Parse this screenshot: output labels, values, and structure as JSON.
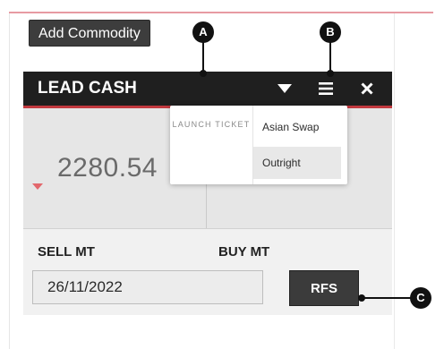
{
  "toolbar": {
    "add_commodity_label": "Add Commodity"
  },
  "widget": {
    "title": "LEAD CASH",
    "price": "2280.54",
    "sell_label": "SELL MT",
    "buy_label": "BUY MT",
    "date_value": "26/11/2022",
    "rfs_label": "RFS"
  },
  "dropdown": {
    "launch_ticket_label": "LAUNCH TICKET",
    "items": [
      {
        "label": "Asian Swap",
        "selected": false
      },
      {
        "label": "Outright",
        "selected": true
      }
    ]
  },
  "callouts": [
    {
      "label": "A",
      "target": "chevron-down-icon"
    },
    {
      "label": "B",
      "target": "menu-icon"
    },
    {
      "label": "C",
      "target": "rfs-button"
    }
  ],
  "colors": {
    "accent_red": "#c2393f",
    "titlebar": "#1f1f1f",
    "price_down": "#e2676c"
  }
}
